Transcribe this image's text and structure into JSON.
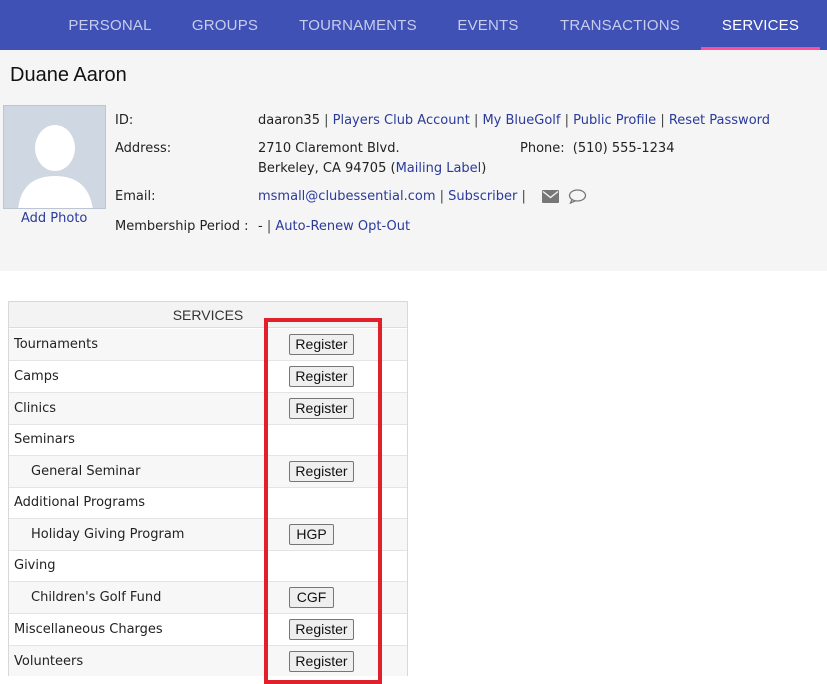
{
  "nav": {
    "tabs": [
      {
        "label": "PERSONAL",
        "active": false
      },
      {
        "label": "GROUPS",
        "active": false
      },
      {
        "label": "TOURNAMENTS",
        "active": false
      },
      {
        "label": "EVENTS",
        "active": false
      },
      {
        "label": "TRANSACTIONS",
        "active": false
      },
      {
        "label": "SERVICES",
        "active": true
      }
    ],
    "bg_color": "#3f51b5",
    "active_underline_color": "#ff4f9a"
  },
  "profile": {
    "name": "Duane Aaron",
    "add_photo": "Add Photo",
    "id_label": "ID:",
    "id_value": "daaron35",
    "id_links": [
      "Players Club Account",
      "My BlueGolf",
      "Public Profile",
      "Reset Password"
    ],
    "address_label": "Address:",
    "address_line1": "2710 Claremont Blvd.",
    "address_line2": "Berkeley, CA 94705",
    "mailing_label": "Mailing Label",
    "phone_label": "Phone:",
    "phone_value": "(510) 555-1234",
    "email_label": "Email:",
    "email_value": "msmall@clubessential.com",
    "subscriber": "Subscriber",
    "membership_label": "Membership Period :",
    "membership_value": "-",
    "auto_renew": "Auto-Renew Opt-Out"
  },
  "services": {
    "header": "SERVICES",
    "rows": [
      {
        "label": "Tournaments",
        "indent": false,
        "button": "Register"
      },
      {
        "label": "Camps",
        "indent": false,
        "button": "Register"
      },
      {
        "label": "Clinics",
        "indent": false,
        "button": "Register"
      },
      {
        "label": "Seminars",
        "indent": false,
        "button": null
      },
      {
        "label": "General Seminar",
        "indent": true,
        "button": "Register"
      },
      {
        "label": "Additional Programs",
        "indent": false,
        "button": null
      },
      {
        "label": "Holiday Giving Program",
        "indent": true,
        "button": "HGP"
      },
      {
        "label": "Giving",
        "indent": false,
        "button": null
      },
      {
        "label": "Children's Golf Fund",
        "indent": true,
        "button": "CGF"
      },
      {
        "label": "Miscellaneous Charges",
        "indent": false,
        "button": "Register"
      },
      {
        "label": "Volunteers",
        "indent": false,
        "button": "Register"
      }
    ]
  },
  "highlight_color": "#e0202a"
}
